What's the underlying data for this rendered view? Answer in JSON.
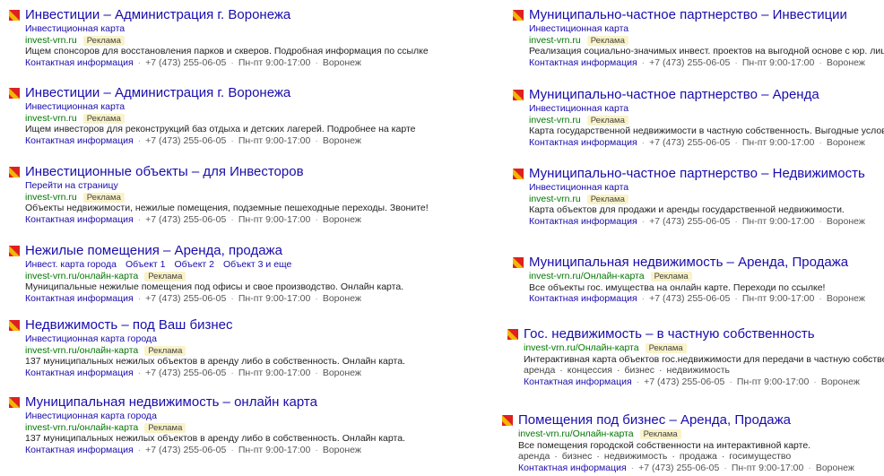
{
  "common": {
    "badge": "Реклама",
    "contact_label": "Контактная информация",
    "phone": "+7 (473) 255-06-05",
    "hours": "Пн-пт 9:00-17:00",
    "city": "Воронеж",
    "favicon_colors": [
      "#f2b705",
      "#e02020"
    ]
  },
  "left_ads": [
    {
      "title": "Инвестиции – Администрация г. Воронежа",
      "sitelinks": [
        "Инвестиционная карта"
      ],
      "url": "invest-vrn.ru",
      "description": "Ищем спонсоров для восстановления парков и скверов. Подробная информация по ссылке"
    },
    {
      "title": "Инвестиции – Администрация г. Воронежа",
      "sitelinks": [
        "Инвестиционная карта"
      ],
      "url": "invest-vrn.ru",
      "description": "Ищем инвесторов для реконструкций баз отдыха и детских лагерей. Подробнее на карте"
    },
    {
      "title": "Инвестиционные объекты – для Инвесторов",
      "sitelinks": [
        "Перейти на страницу"
      ],
      "url": "invest-vrn.ru",
      "description": "Объекты недвижимости, нежилые помещения, подземные пешеходные переходы. Звоните!"
    },
    {
      "title": "Нежилые помещения – Аренда, продажа",
      "sitelinks": [
        "Инвест. карта города",
        "Объект 1",
        "Объект 2",
        "Объект 3 и еще"
      ],
      "url": "invest-vrn.ru/онлайн-карта",
      "description": "Муниципальные нежилые помещения под офисы и свое производство. Онлайн карта."
    },
    {
      "title": "Недвижимость – под Ваш бизнес",
      "sitelinks": [
        "Инвестиционная карта города"
      ],
      "url": "invest-vrn.ru/онлайн-карта",
      "description": "137 муниципальных нежилых объектов в аренду либо в собственность. Онлайн карта."
    },
    {
      "title": "Муниципальная недвижимость – онлайн карта",
      "sitelinks": [
        "Инвестиционная карта города"
      ],
      "url": "invest-vrn.ru/онлайн-карта",
      "description": "137 муниципальных нежилых объектов в аренду либо в собственность. Онлайн карта."
    }
  ],
  "right_ads": [
    {
      "title": "Муниципально-частное партнерство – Инвестиции",
      "sitelinks": [
        "Инвестиционная карта"
      ],
      "url": "invest-vrn.ru",
      "description": "Реализация социально-значимых инвест. проектов на выгодной основе с юр. лицами"
    },
    {
      "title": "Муниципально-частное партнерство – Аренда",
      "sitelinks": [
        "Инвестиционная карта"
      ],
      "url": "invest-vrn.ru",
      "description": "Карта государственной недвижимости в частную собственность. Выгодные условия!"
    },
    {
      "title": "Муниципально-частное партнерство – Недвижимость",
      "sitelinks": [
        "Инвестиционная карта"
      ],
      "url": "invest-vrn.ru",
      "description": "Карта объектов для продажи и аренды государственной недвижимости."
    },
    {
      "title": "Муниципальная недвижимость – Аренда, Продажа",
      "sitelinks": [],
      "url": "invest-vrn.ru/Онлайн-карта",
      "description": "Все объекты гос. имущества на онлайн карте. Переходи по ссылке!"
    },
    {
      "title": "Гос. недвижимость – в частную собственность",
      "sitelinks": [],
      "url": "invest-vrn.ru/Онлайн-карта",
      "description": "Интерактивная карта объектов гос.недвижимости для передачи в частную собственность",
      "tags": [
        "аренда",
        "концессия",
        "бизнес",
        "недвижимость"
      ]
    },
    {
      "title": "Помещения под бизнес – Аренда, Продажа",
      "sitelinks": [],
      "url": "invest-vrn.ru/Онлайн-карта",
      "description": "Все помещения городской собственности на интерактивной карте.",
      "tags": [
        "аренда",
        "бизнес",
        "недвижимость",
        "продажа",
        "госимущество"
      ]
    }
  ]
}
